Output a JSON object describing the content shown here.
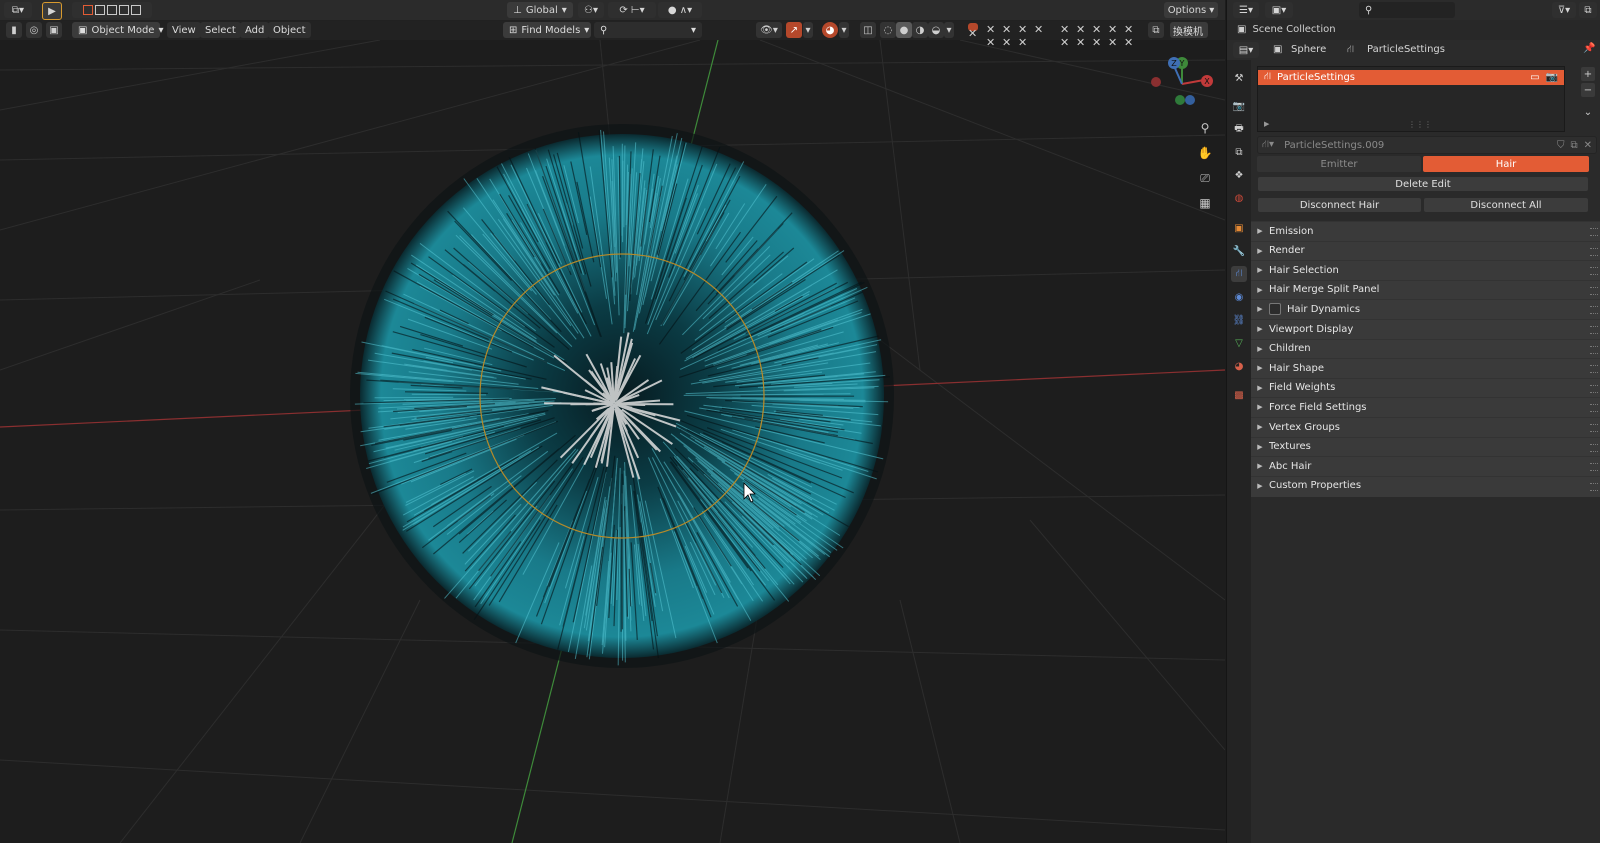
{
  "viewport_header": {
    "transform_orientation": "Global",
    "options_label": "Options",
    "mode_label": "Object Mode",
    "menus": [
      "View",
      "Select",
      "Add",
      "Object"
    ],
    "find_models": "Find Models",
    "cjk_label": "換模机"
  },
  "outliner": {
    "scene_collection": "Scene Collection",
    "breadcrumb_object": "Sphere",
    "breadcrumb_settings": "ParticleSettings"
  },
  "properties": {
    "particle_system_name": "ParticleSettings",
    "settings_datablock": "ParticleSettings.009",
    "type_options": [
      "Emitter",
      "Hair"
    ],
    "type_selected": "Hair",
    "delete_edit": "Delete Edit",
    "disconnect_hair": "Disconnect Hair",
    "disconnect_all": "Disconnect All",
    "panels": [
      {
        "label": "Emission"
      },
      {
        "label": "Render"
      },
      {
        "label": "Hair Selection"
      },
      {
        "label": "Hair Merge Split Panel"
      },
      {
        "label": "Hair Dynamics",
        "checkbox": true
      },
      {
        "label": "Viewport Display"
      },
      {
        "label": "Children"
      },
      {
        "label": "Hair Shape"
      },
      {
        "label": "Field Weights"
      },
      {
        "label": "Force Field Settings"
      },
      {
        "label": "Vertex Groups"
      },
      {
        "label": "Textures"
      },
      {
        "label": "Abc Hair"
      },
      {
        "label": "Custom Properties"
      }
    ]
  },
  "gizmo_axes": {
    "x": "X",
    "y": "Y",
    "z": "Z"
  },
  "colors": {
    "accent_orange": "#e35c35",
    "hair_teal": "#1f8a9a",
    "axis_red": "#b8393a",
    "axis_green": "#3e8a3a"
  }
}
